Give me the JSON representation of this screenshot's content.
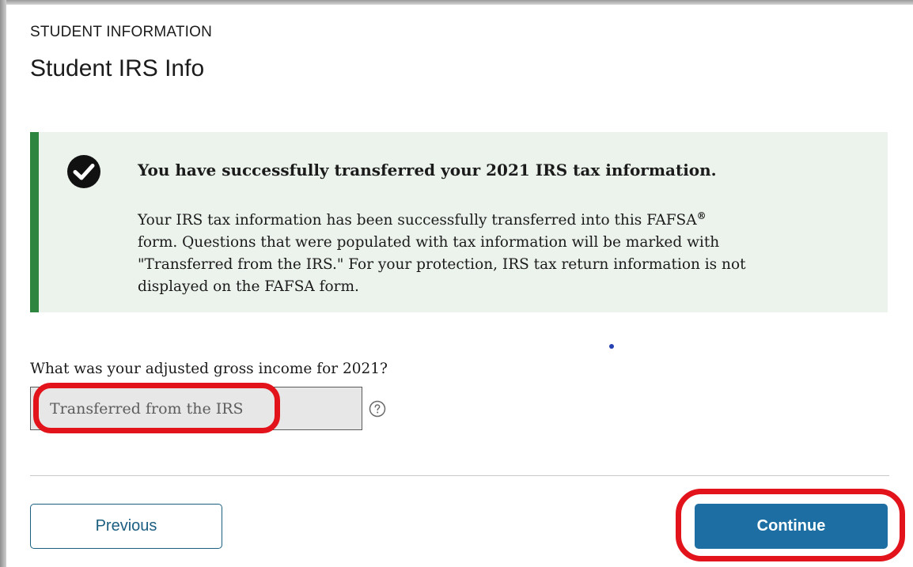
{
  "header": {
    "section_label": "STUDENT INFORMATION",
    "title": "Student IRS Info"
  },
  "alert": {
    "type": "success",
    "icon": "check-circle-icon",
    "heading": "You have successfully transferred your 2021 IRS tax information.",
    "body_line_1": "Your IRS tax information has been successfully transferred into this FAFSA",
    "body_registered_mark": "®",
    "body_line_1_end": "",
    "body_line_2": "form. Questions that were populated with tax information will be marked with",
    "body_line_3": "\"Transferred from the IRS.\" For your protection, IRS tax return information is not",
    "body_line_4": "displayed on the FAFSA form."
  },
  "question": {
    "label": "What was your adjusted gross income for 2021?",
    "value": "Transferred from the IRS",
    "help_icon": "question-circle-icon"
  },
  "navigation": {
    "previous_label": "Previous",
    "continue_label": "Continue"
  },
  "colors": {
    "alert_bg": "#ecf3ec",
    "alert_border": "#2e8540",
    "primary_button": "#1d6fa3",
    "secondary_button_text": "#1a5e80",
    "annotation_ring": "#e3131b"
  }
}
